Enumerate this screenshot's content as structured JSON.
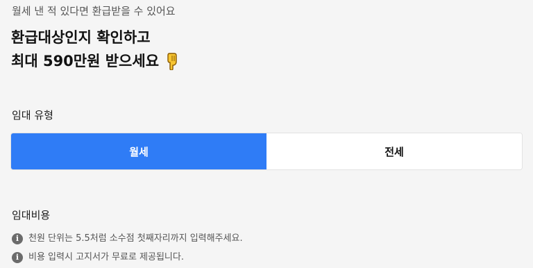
{
  "intro": {
    "subtitle": "월세 낸 적 있다면 환급받을 수 있어요",
    "headline_line1": "환급대상인지 확인하고",
    "headline_line2": "최대 590만원 받으세요",
    "headline_icon": "pointing-hand-down-icon"
  },
  "rent_type": {
    "label": "임대 유형",
    "options": [
      "월세",
      "전세"
    ],
    "selected": "월세"
  },
  "rent_cost": {
    "label": "임대비용",
    "notes": [
      "천원 단위는 5.5처럼 소수점 첫째자리까지 입력해주세요.",
      "비용 입력시 고지서가 무료로 제공됩니다."
    ]
  },
  "colors": {
    "accent": "#2f7cf6",
    "background": "#f5f5f5",
    "info_icon": "#6b6b6b"
  }
}
